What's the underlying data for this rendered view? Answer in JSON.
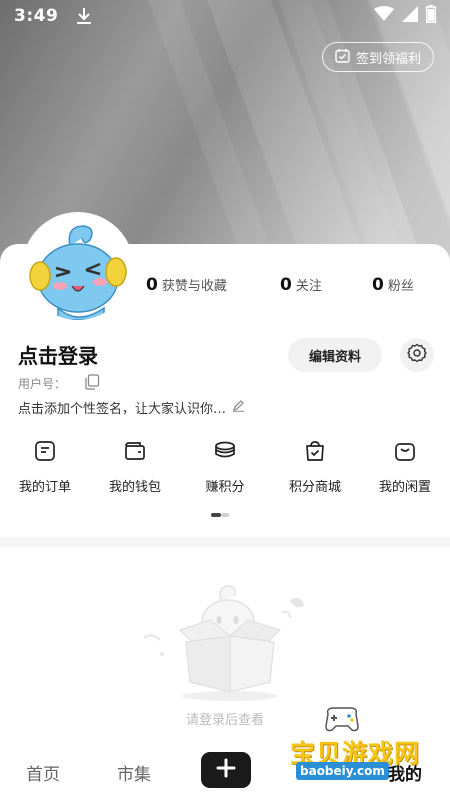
{
  "status_bar": {
    "time": "3:49"
  },
  "header": {
    "signin_label": "签到领福利"
  },
  "stats": [
    {
      "num": "0",
      "label": "获赞与收藏"
    },
    {
      "num": "0",
      "label": "关注"
    },
    {
      "num": "0",
      "label": "粉丝"
    }
  ],
  "profile": {
    "login_title": "点击登录",
    "edit_label": "编辑资料",
    "userid_label": "用户号：",
    "bio": "点击添加个性签名，让大家认识你…"
  },
  "menu": [
    {
      "label": "我的订单",
      "icon": "order-icon"
    },
    {
      "label": "我的钱包",
      "icon": "wallet-icon"
    },
    {
      "label": "赚积分",
      "icon": "coins-icon"
    },
    {
      "label": "积分商城",
      "icon": "points-mall-icon"
    },
    {
      "label": "我的闲置",
      "icon": "idle-bag-icon"
    }
  ],
  "empty": {
    "text": "请登录后查看"
  },
  "bottom_nav": {
    "home": "首页",
    "market": "市集",
    "me": "我的"
  },
  "watermark": {
    "title": "宝贝游戏网",
    "url": "baobeiy.com"
  },
  "colors": {
    "dark": "#1a1a1a",
    "header_gray": "#9a9a9a",
    "watermark_yellow": "#f5c518",
    "watermark_blue": "#2b8fd6"
  }
}
